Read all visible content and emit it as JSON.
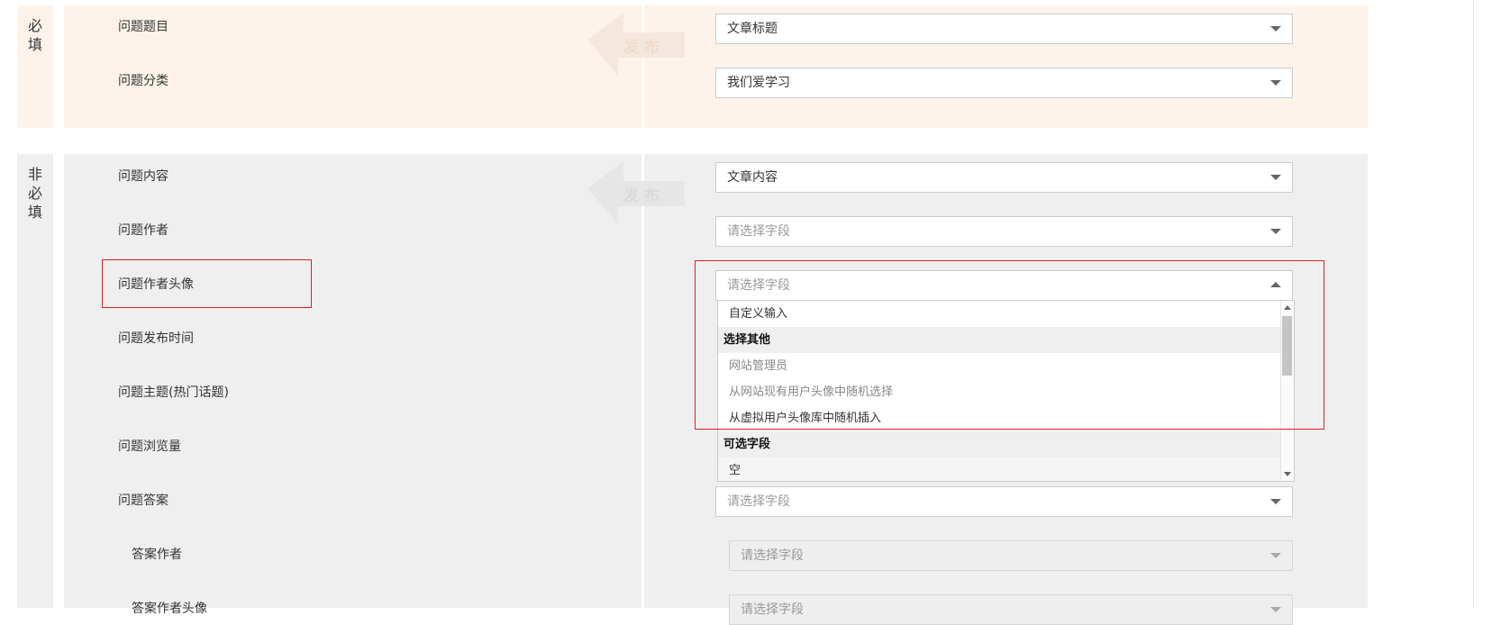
{
  "sections": {
    "required": {
      "label_line1": "必",
      "label_line2": "填"
    },
    "optional": {
      "label_line1": "非",
      "label_line2": "必",
      "label_line3": "填"
    }
  },
  "watermark": {
    "text": "发布"
  },
  "fields": {
    "title": {
      "label": "问题题目",
      "value": "文章标题"
    },
    "category": {
      "label": "问题分类",
      "value": "我们爱学习"
    },
    "content": {
      "label": "问题内容",
      "value": "文章内容"
    },
    "author": {
      "label": "问题作者",
      "placeholder": "请选择字段"
    },
    "author_avatar": {
      "label": "问题作者头像",
      "placeholder": "请选择字段"
    },
    "publish_time": {
      "label": "问题发布时间"
    },
    "topic": {
      "label": "问题主题(热门话题)"
    },
    "views": {
      "label": "问题浏览量"
    },
    "answer": {
      "label": "问题答案",
      "placeholder": "请选择字段"
    },
    "answer_author": {
      "label": "答案作者",
      "placeholder": "请选择字段"
    },
    "answer_author_avatar": {
      "label": "答案作者头像",
      "placeholder": "请选择字段"
    }
  },
  "dropdown": {
    "custom_input": "自定义输入",
    "group_other": "选择其他",
    "site_admin": "网站管理员",
    "random_existing": "从网站现有用户头像中随机选择",
    "random_virtual": "从虚拟用户头像库中随机插入",
    "group_fields": "可选字段",
    "empty": "空"
  },
  "colors": {
    "required_bg": "#fdf3ea",
    "optional_bg": "#efefef",
    "highlight": "#e02020"
  }
}
